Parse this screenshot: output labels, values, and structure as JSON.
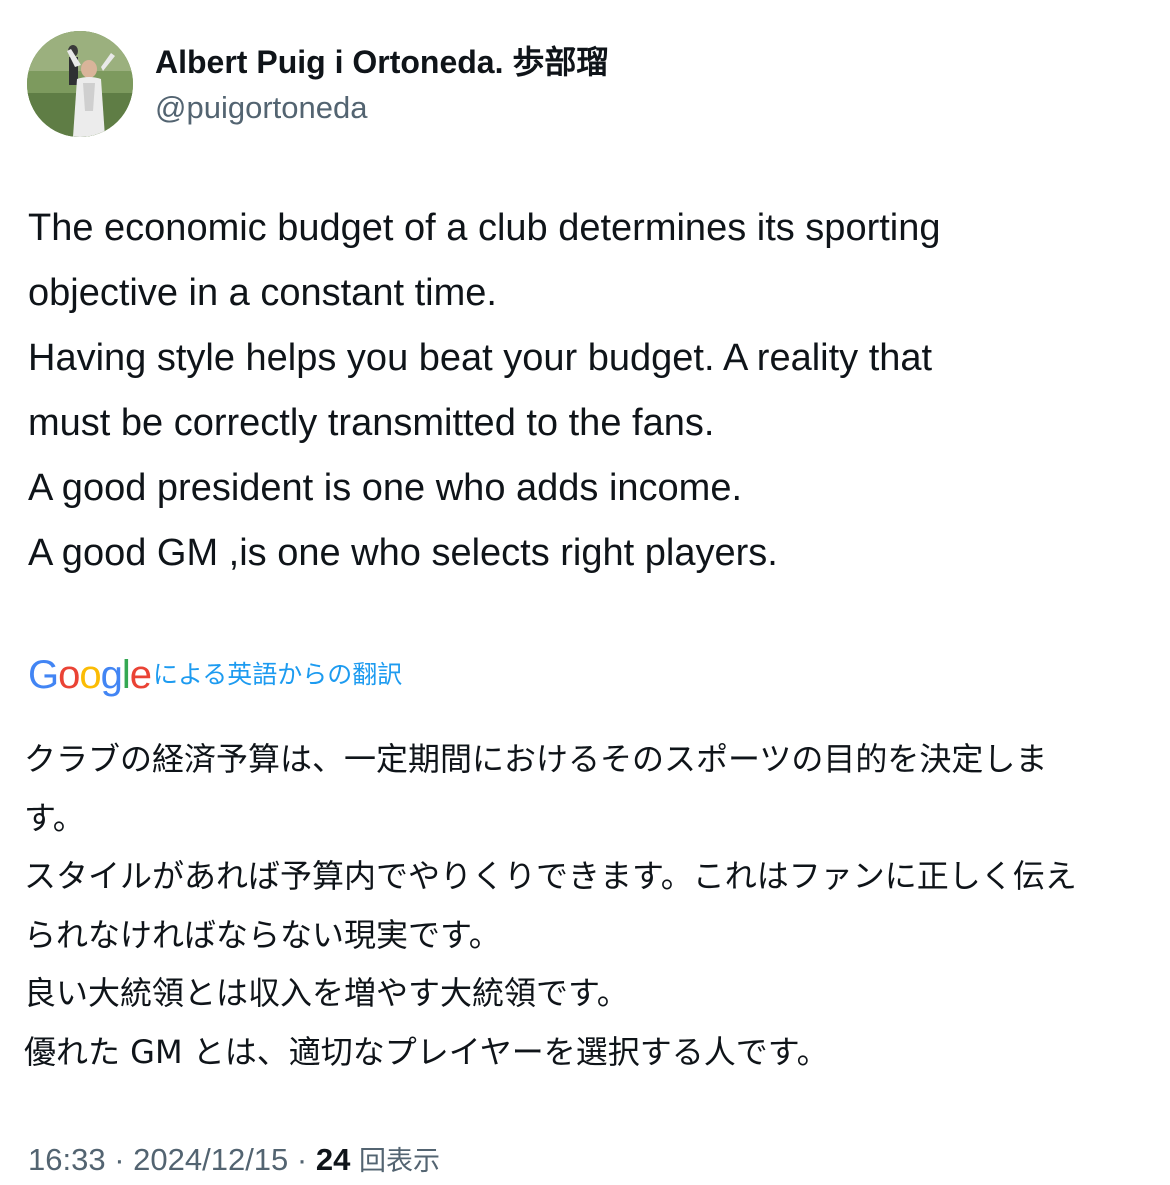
{
  "author": {
    "display_name": "Albert Puig i Ortoneda. 歩部瑠",
    "handle": "@puigortoneda",
    "avatar_icon": "profile-photo"
  },
  "tweet": {
    "lines": [
      "The economic budget of a club determines its sporting",
      "objective in a constant time.",
      "Having style helps you beat your budget. A reality that",
      "must be correctly transmitted to the fans.",
      "A good president is one who adds income.",
      "A good GM ,is one who selects right players."
    ]
  },
  "translation": {
    "logo_text": "Google",
    "label": "による英語からの翻訳",
    "lines": [
      "クラブの経済予算は、一定期間におけるそのスポーツの目的を決定しま",
      "す。",
      "スタイルがあれば予算内でやりくりできます。これはファンに正しく伝え",
      "られなければならない現実です。",
      "良い大統領とは収入を増やす大統領です。",
      "優れた GM とは、適切なプレイヤーを選択する人です。"
    ]
  },
  "meta": {
    "time": "16:33",
    "separator": "·",
    "date": "2024/12/15",
    "views_count": "24",
    "views_label": "回表示"
  },
  "colors": {
    "text_primary": "#0f1419",
    "text_secondary": "#536471",
    "link_blue": "#1d9bf0",
    "google_blue": "#4285F4",
    "google_red": "#EA4335",
    "google_yellow": "#FBBC05",
    "google_green": "#34A853"
  }
}
